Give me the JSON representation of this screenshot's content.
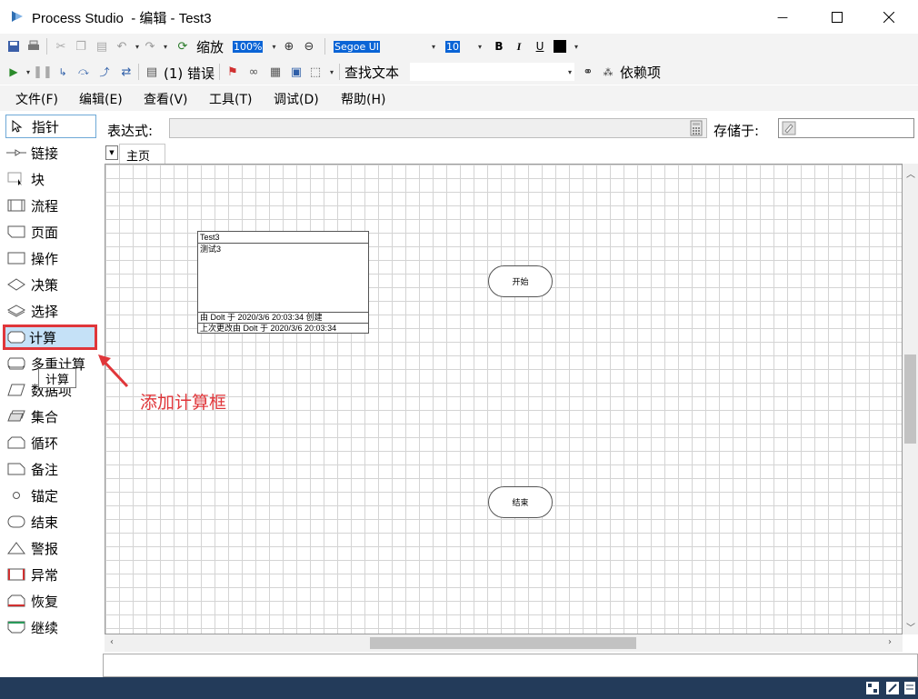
{
  "window": {
    "title": "Process Studio  - 编辑 - Test3",
    "min_glyph": "—",
    "max_glyph": "☐",
    "close_glyph": "✕"
  },
  "toolbar1": {
    "zoom_label": "缩放",
    "zoom_value": "100%",
    "font_name": "Segoe UI",
    "font_size": "10",
    "bold": "B",
    "italic": "I",
    "underline": "U"
  },
  "toolbar2": {
    "errors_label": "(1) 错误",
    "find_text_label": "查找文本",
    "dependencies_label": "依赖项"
  },
  "menu": [
    "文件(F)",
    "编辑(E)",
    "查看(V)",
    "工具(T)",
    "调试(D)",
    "帮助(H)"
  ],
  "palette": [
    {
      "label": "指针",
      "icon": "pointer-icon"
    },
    {
      "label": "链接",
      "icon": "link-icon"
    },
    {
      "label": "块",
      "icon": "block-icon"
    },
    {
      "label": "流程",
      "icon": "process-icon"
    },
    {
      "label": "页面",
      "icon": "page-icon"
    },
    {
      "label": "操作",
      "icon": "action-icon"
    },
    {
      "label": "决策",
      "icon": "decision-icon"
    },
    {
      "label": "选择",
      "icon": "choice-icon"
    },
    {
      "label": "计算",
      "icon": "calculation-icon"
    },
    {
      "label": "多重计算",
      "icon": "multi-calculation-icon"
    },
    {
      "label": "数据项",
      "icon": "data-item-icon"
    },
    {
      "label": "集合",
      "icon": "collection-icon"
    },
    {
      "label": "循环",
      "icon": "loop-icon"
    },
    {
      "label": "备注",
      "icon": "note-icon"
    },
    {
      "label": "锚定",
      "icon": "anchor-icon"
    },
    {
      "label": "结束",
      "icon": "end-icon"
    },
    {
      "label": "警报",
      "icon": "alert-icon"
    },
    {
      "label": "异常",
      "icon": "exception-icon"
    },
    {
      "label": "恢复",
      "icon": "recover-icon"
    },
    {
      "label": "继续",
      "icon": "resume-icon"
    }
  ],
  "expression": {
    "label": "表达式:",
    "value": "",
    "store_label": "存储于:",
    "store_value": ""
  },
  "tabs": {
    "main": "主页"
  },
  "canvas": {
    "info_box": {
      "title": "Test3",
      "description": "测试3",
      "created": "由 Dolt 于 2020/3/6  20:03:34 创建",
      "modified": "上次更改由 Dolt 于 2020/3/6 20:03:34"
    },
    "start_node": "开始",
    "end_node": "结束"
  },
  "tooltip": "计算",
  "annotation": "添加计算框",
  "colors": {
    "highlight_border": "#e0363a",
    "selected_fill": "#c5e1f7",
    "status_bar": "#233b5a"
  }
}
